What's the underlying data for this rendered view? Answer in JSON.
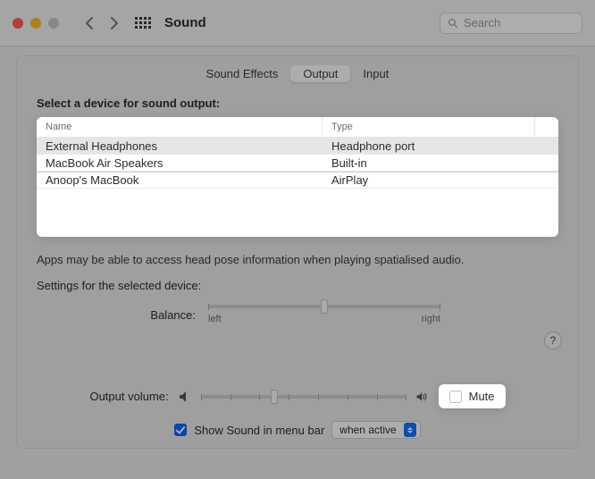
{
  "window": {
    "title": "Sound"
  },
  "search": {
    "placeholder": "Search"
  },
  "tabs": {
    "sound_effects": "Sound Effects",
    "output": "Output",
    "input": "Input",
    "active": "output"
  },
  "output": {
    "heading": "Select a device for sound output:",
    "columns": {
      "name": "Name",
      "type": "Type"
    },
    "devices": [
      {
        "name": "External Headphones",
        "type": "Headphone port",
        "selected": true
      },
      {
        "name": "MacBook Air Speakers",
        "type": "Built-in",
        "selected": false
      },
      {
        "name": "Anoop's MacBook",
        "type": "AirPlay",
        "selected": false
      }
    ],
    "hint": "Apps may be able to access head pose information when playing spatialised audio.",
    "settings_label": "Settings for the selected device:",
    "balance": {
      "label": "Balance:",
      "left": "left",
      "right": "right",
      "value": 0.5
    }
  },
  "volume": {
    "label": "Output volume:",
    "value": 0.35,
    "mute_label": "Mute",
    "mute_checked": false
  },
  "menubar": {
    "checkbox_label": "Show Sound in menu bar",
    "checked": true,
    "select_value": "when active"
  }
}
